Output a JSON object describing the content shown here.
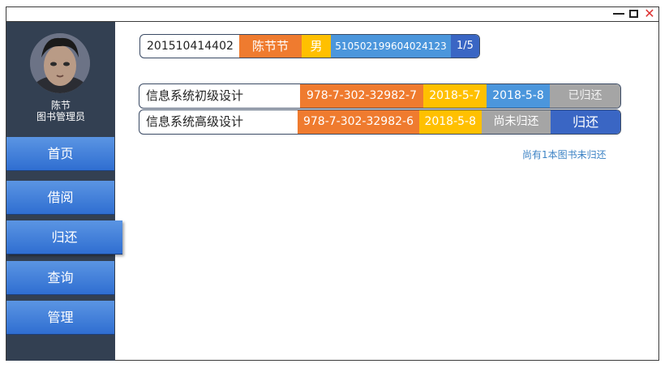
{
  "user": {
    "name": "陈节",
    "role": "图书管理员"
  },
  "nav": {
    "items": [
      {
        "label": "首页"
      },
      {
        "label": "借阅"
      },
      {
        "label": "归还"
      },
      {
        "label": "查询"
      },
      {
        "label": "管理"
      }
    ],
    "active": "归还"
  },
  "reader": {
    "student_id": "201510414402",
    "name": "陈节节",
    "gender": "男",
    "id_number": "510502199604024123",
    "count": "1/5"
  },
  "books": [
    {
      "title": "信息系统初级设计",
      "isbn": "978-7-302-32982-7",
      "borrow_date": "2018-5-7",
      "return_date": "2018-5-8",
      "status": "已归还"
    },
    {
      "title": "信息系统高级设计",
      "isbn": "978-7-302-32982-6",
      "borrow_date": "2018-5-8",
      "return_date": "尚未归还",
      "action": "归还"
    }
  ],
  "note": "尚有1本图书未归还",
  "colors": {
    "sidebar": "#334052",
    "orange": "#ef7b2f",
    "yellow": "#ffc000",
    "blue": "#4b96dc",
    "dark_blue": "#3a66c4",
    "gray": "#a5a5a5"
  }
}
